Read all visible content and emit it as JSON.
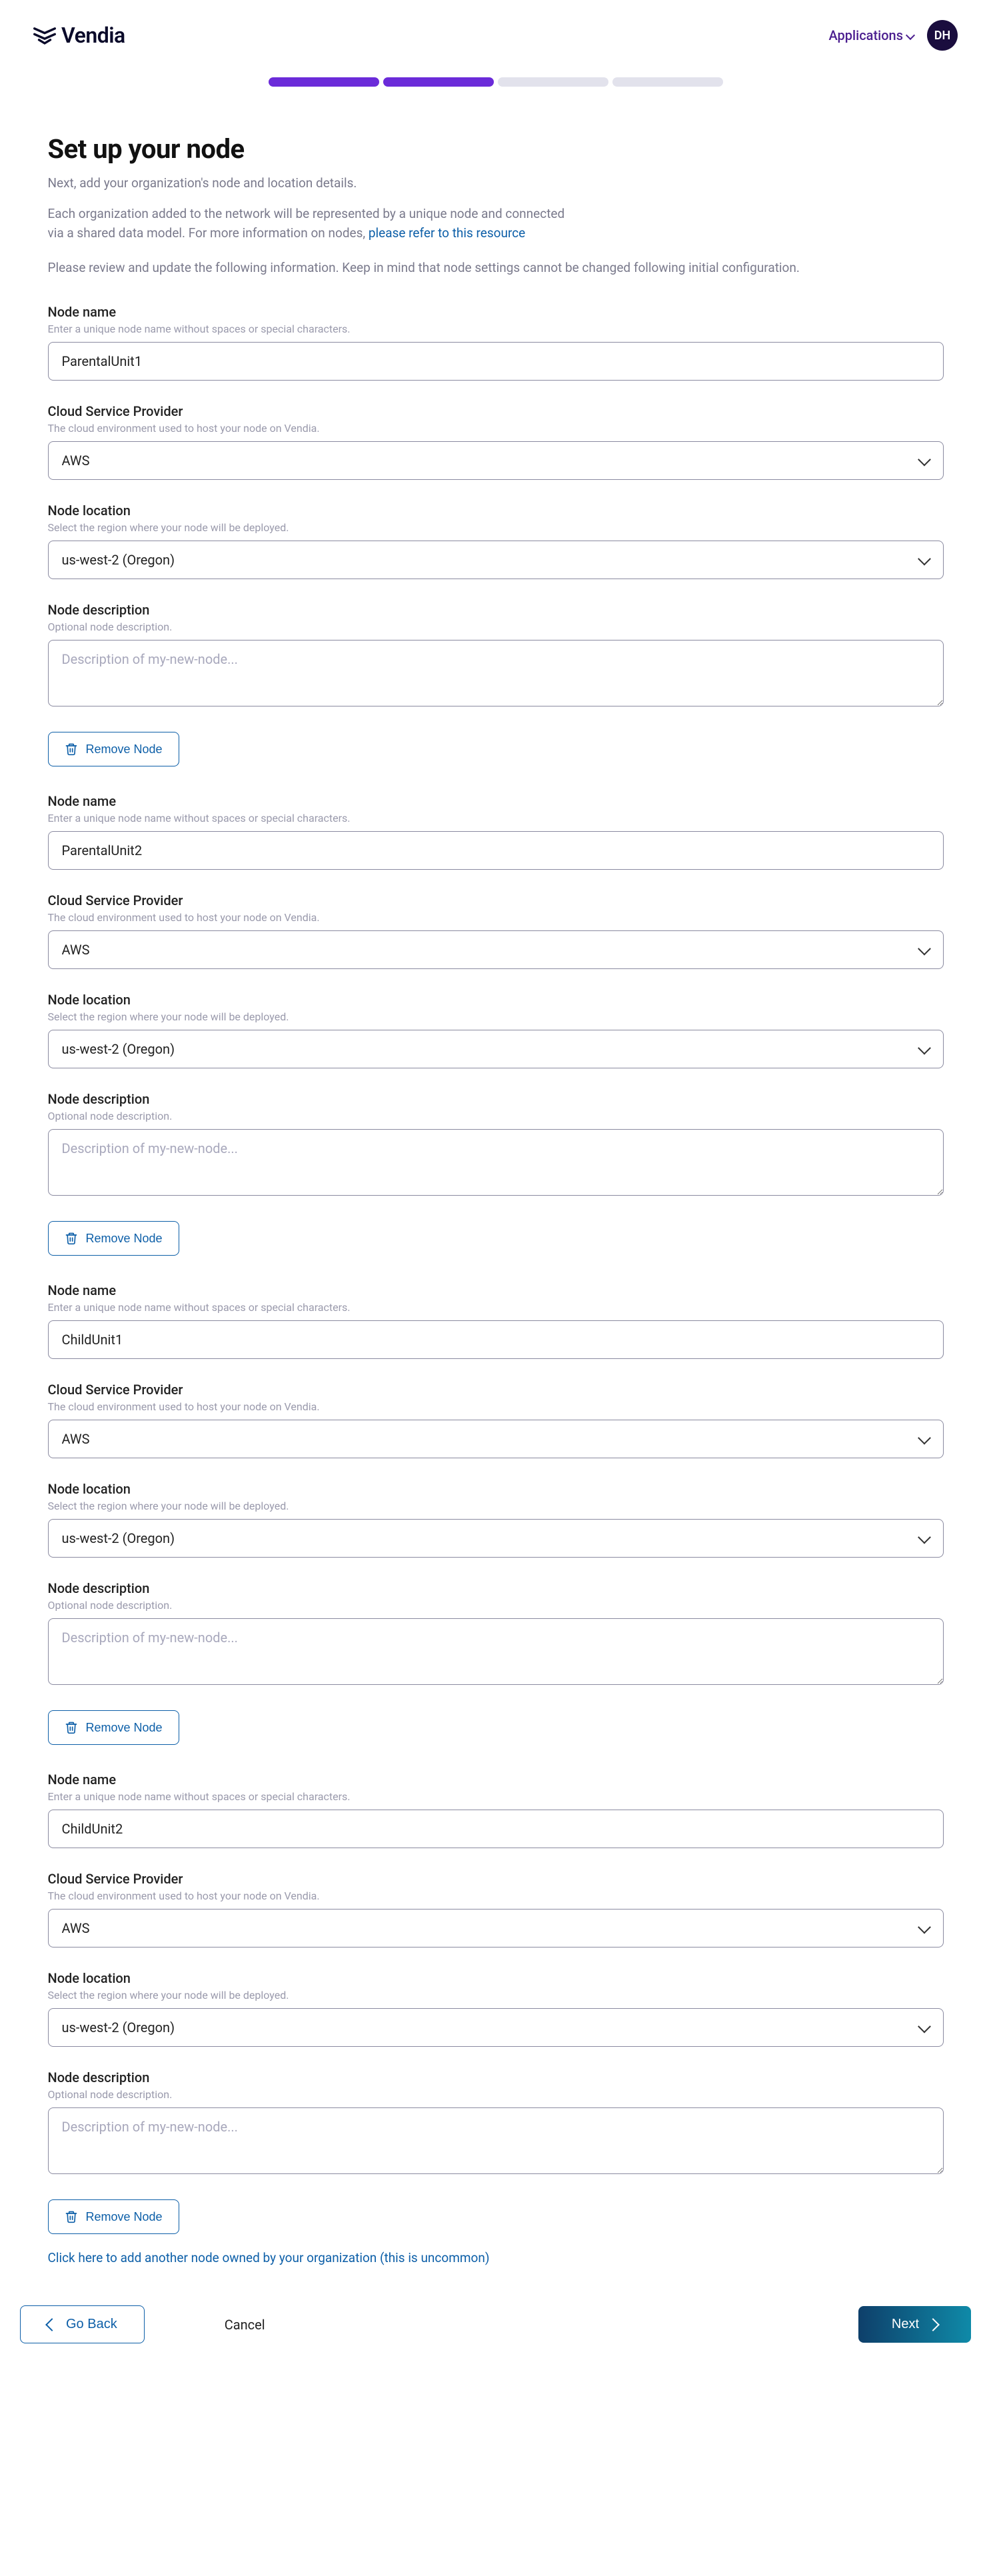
{
  "brand": {
    "name": "Vendia"
  },
  "header": {
    "applications_label": "Applications",
    "avatar_initials": "DH"
  },
  "progress": {
    "total_steps": 4,
    "completed_steps": 2
  },
  "page": {
    "title": "Set up your node",
    "subtitle": "Next, add your organization's node and location details.",
    "intro_line1": "Each organization added to the network will be represented by a unique node and connected",
    "intro_line2_prefix": "via a shared data model. For more information on nodes, ",
    "intro_link": "please refer to this resource",
    "review_line": "Please review and update the following information. Keep in mind that node settings cannot be changed following initial configuration."
  },
  "labels": {
    "node_name": "Node name",
    "node_name_hint": "Enter a unique node name without spaces or special characters.",
    "csp": "Cloud Service Provider",
    "csp_hint": "The cloud environment used to host your node on Vendia.",
    "location": "Node location",
    "location_hint": "Select the region where your node will be deployed.",
    "description": "Node description",
    "description_hint": "Optional node description.",
    "description_placeholder": "Description of my-new-node...",
    "remove_node": "Remove Node",
    "add_node": "Click here to add another node owned by your organization (this is uncommon)"
  },
  "footer": {
    "go_back": "Go Back",
    "cancel": "Cancel",
    "next": "Next"
  },
  "nodes": [
    {
      "name": "ParentalUnit1",
      "csp": "AWS",
      "location": "us-west-2 (Oregon)",
      "description": ""
    },
    {
      "name": "ParentalUnit2",
      "csp": "AWS",
      "location": "us-west-2 (Oregon)",
      "description": ""
    },
    {
      "name": "ChildUnit1",
      "csp": "AWS",
      "location": "us-west-2 (Oregon)",
      "description": ""
    },
    {
      "name": "ChildUnit2",
      "csp": "AWS",
      "location": "us-west-2 (Oregon)",
      "description": ""
    }
  ]
}
